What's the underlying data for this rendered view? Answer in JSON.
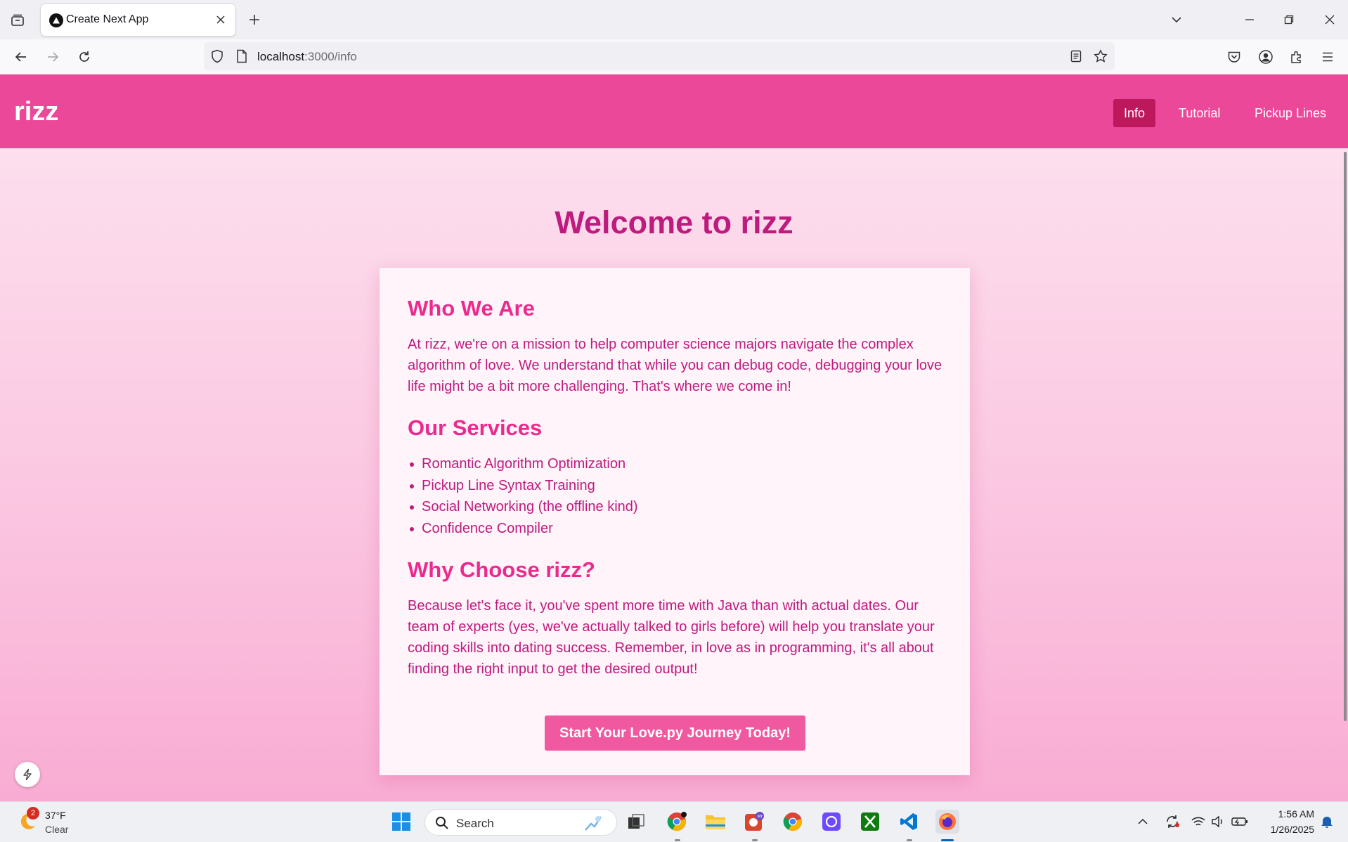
{
  "browser": {
    "tab_title": "Create Next App",
    "url_host": "localhost",
    "url_path": ":3000/info"
  },
  "site": {
    "logo": "rizz",
    "nav": [
      {
        "label": "Info",
        "active": true
      },
      {
        "label": "Tutorial",
        "active": false
      },
      {
        "label": "Pickup Lines",
        "active": false
      }
    ],
    "welcome": "Welcome to rizz",
    "sections": {
      "who_heading": "Who We Are",
      "who_text": "At rizz, we're on a mission to help computer science majors navigate the complex algorithm of love. We understand that while you can debug code, debugging your love life might be a bit more challenging. That's where we come in!",
      "services_heading": "Our Services",
      "services": [
        "Romantic Algorithm Optimization",
        "Pickup Line Syntax Training",
        "Social Networking (the offline kind)",
        "Confidence Compiler"
      ],
      "why_heading": "Why Choose rizz?",
      "why_text": "Because let's face it, you've spent more time with Java than with actual dates. Our team of experts (yes, we've actually talked to girls before) will help you translate your coding skills into dating success. Remember, in love as in programming, it's all about finding the right input to get the desired output!"
    },
    "cta_label": "Start Your Love.py Journey Today!"
  },
  "taskbar": {
    "weather_badge": "2",
    "weather_temp": "37°F",
    "weather_condition": "Clear",
    "search_label": "Search",
    "time": "1:56 AM",
    "date": "1/26/2025"
  },
  "colors": {
    "header": "#ec4899",
    "nav_active": "#be185d",
    "heading": "#ec2a8e",
    "body_text": "#be1b7e",
    "cta": "#f0599f"
  }
}
